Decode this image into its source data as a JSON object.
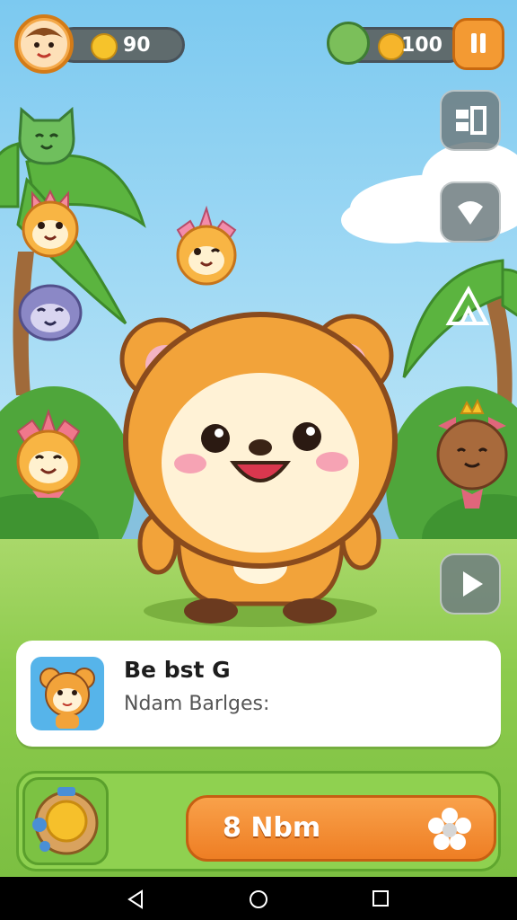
{
  "hud": {
    "left_value": "90",
    "right_value": "100"
  },
  "card": {
    "title": "Be bst G",
    "subtitle": "Ndam Barlges:"
  },
  "action": {
    "label": "8 Nbm"
  },
  "colors": {
    "accent": "#ee7e24",
    "ground": "#8ccb4c",
    "sky": "#7cc9f0"
  },
  "icons": {
    "top_left_avatar": "monkey-avatar-icon",
    "left_pill_icon": "sprout-coin-icon",
    "right_pill_avatar": "fruit-creature-icon",
    "right_pill_icon": "carrot-icon",
    "menu": "pause-menu-icon",
    "side_buttons": [
      "inventory-icon",
      "shield-icon",
      "tent-icon",
      "play-icon"
    ],
    "bottom_left": "capsule-ball-icon",
    "action_icon": "flower-gear-icon"
  }
}
